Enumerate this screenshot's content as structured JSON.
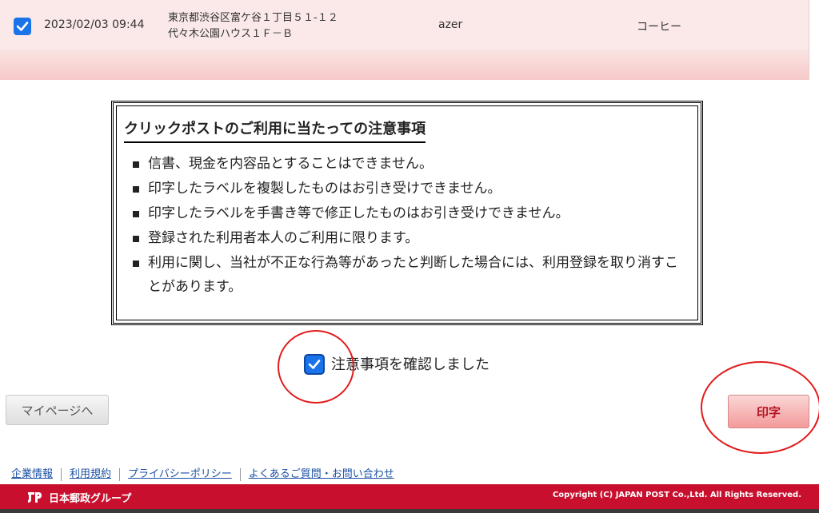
{
  "table_row": {
    "checked": true,
    "datetime": "2023/02/03 09:44",
    "address_line1": "東京都渋谷区富ケ谷１丁目５１-１２",
    "address_line2": "代々木公園ハウス１Ｆ－Ｂ",
    "name": "azer",
    "item": "コーヒー"
  },
  "notice": {
    "title": "クリックポストのご利用に当たっての注意事項",
    "items": [
      "信書、現金を内容品とすることはできません。",
      "印字したラベルを複製したものはお引き受けできません。",
      "印字したラベルを手書き等で修正したものはお引き受けできません。",
      "登録された利用者本人のご利用に限ります。",
      "利用に関し、当社が不正な行為等があったと判断した場合には、利用登録を取り消すことがあります。"
    ]
  },
  "confirm": {
    "checked": true,
    "label": "注意事項を確認しました"
  },
  "buttons": {
    "mypage": "マイページへ",
    "print": "印字"
  },
  "footer_links": [
    "企業情報",
    "利用規約",
    "プライバシーポリシー",
    "よくあるご質問・お問い合わせ"
  ],
  "footer": {
    "logo_text": "日本郵政グループ",
    "copyright": "Copyright (C) JAPAN POST Co.,Ltd.  All Rights Reserved."
  },
  "colors": {
    "brand_red": "#c8102e",
    "checkbox_blue": "#1a73e8",
    "annotation_red": "#e21b1b"
  }
}
